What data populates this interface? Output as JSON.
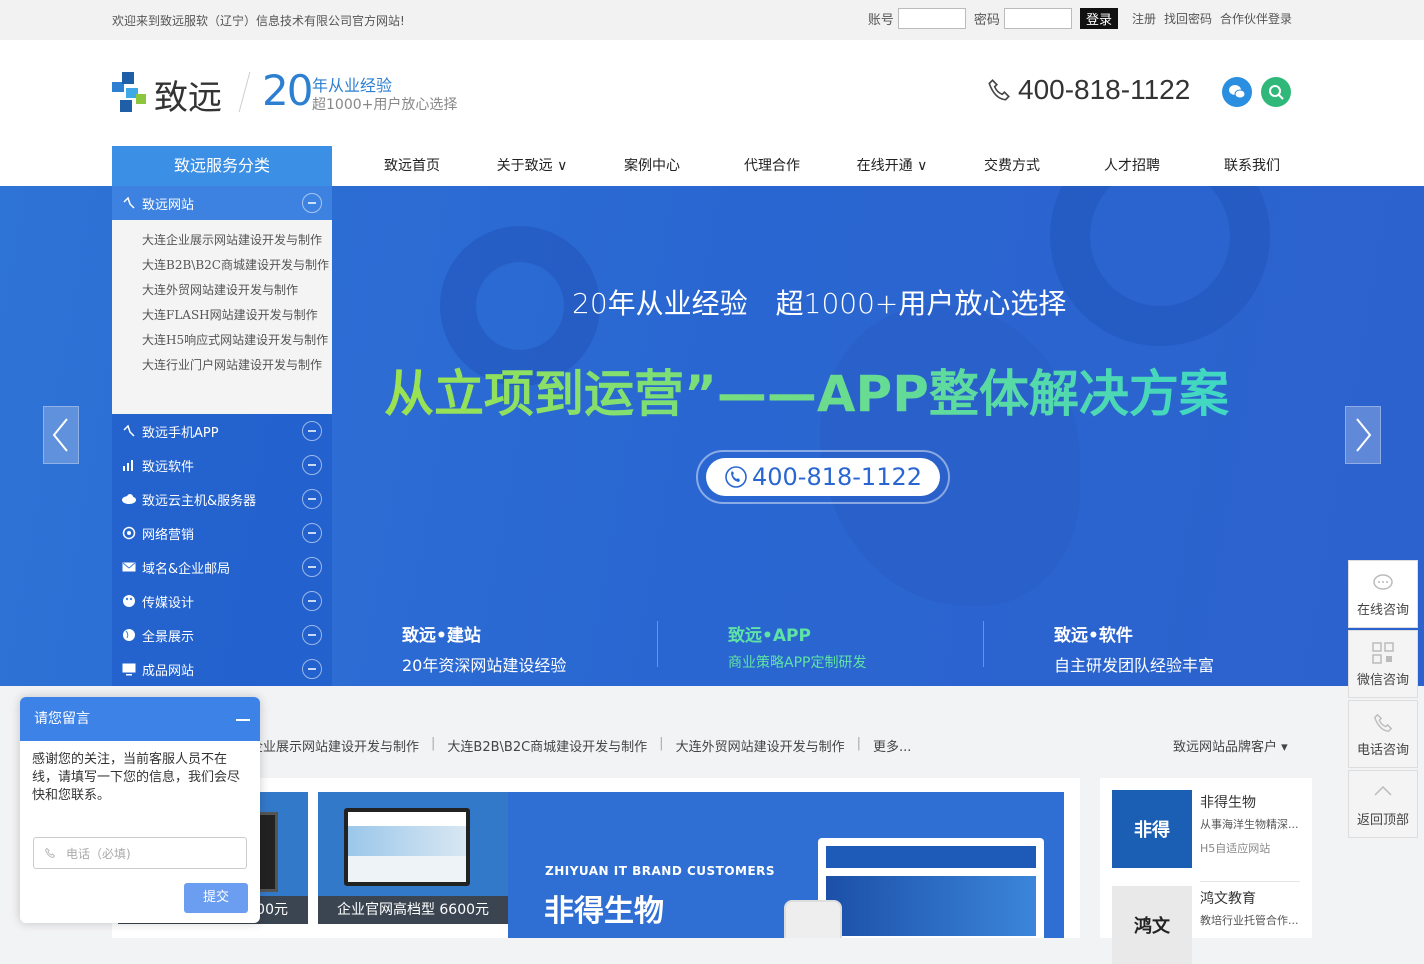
{
  "topbar": {
    "welcome": "欢迎来到致远服软（辽宁）信息技术有限公司官方网站!",
    "account_label": "账号",
    "password_label": "密码",
    "login_button": "登录",
    "register": "注册",
    "forgot": "找回密码",
    "partner_login": "合作伙伴登录"
  },
  "header": {
    "logo_text": "致远",
    "slogan_number": "20",
    "slogan_line1": "年从业经验",
    "slogan_line2": "超1000+用户放心选择",
    "phone": "400-818-1122"
  },
  "nav": {
    "service_head": "致远服务分类",
    "items": [
      "致远首页",
      "关于致远 ∨",
      "案例中心",
      "代理合作",
      "在线开通 ∨",
      "交费方式",
      "人才招聘",
      "联系我们"
    ]
  },
  "sidemenu": {
    "open_category": "致远网站",
    "sub_items": [
      "大连企业展示网站建设开发与制作",
      "大连B2B\\B2C商城建设开发与制作",
      "大连外贸网站建设开发与制作",
      "大连FLASH网站建设开发与制作",
      "大连H5响应式网站建设开发与制作",
      "大连行业门户网站建设开发与制作"
    ],
    "categories": [
      "致远手机APP",
      "致远软件",
      "致远云主机&服务器",
      "网络营销",
      "域名&企业邮局",
      "传媒设计",
      "全景展示",
      "成品网站"
    ]
  },
  "banner": {
    "subtitle": "20年从业经验　超1000+用户放心选择",
    "title": "从立项到运营”——APP整体解决方案",
    "phone": "400-818-1122",
    "features": [
      {
        "title": "致远•建站",
        "sub": "20年资深网站建设经验"
      },
      {
        "title": "致远•APP",
        "sub": "商业策略APP定制研发"
      },
      {
        "title": "致远•软件",
        "sub": "自主研发团队经验丰富"
      }
    ]
  },
  "cases": {
    "tabs": [
      "企业展示网站建设开发与制作",
      "大连B2B\\B2C商城建设开发与制作",
      "大连外贸网站建设开发与制作",
      "更多..."
    ],
    "brand_select": "致远网站品牌客户 ▾",
    "card1_caption": "00元",
    "card2_caption": "企业官网高档型 6600元",
    "big_en": "ZHIYUAN IT BRAND CUSTOMERS",
    "big_cn": "非得生物"
  },
  "clients": [
    {
      "name": "非得生物",
      "desc": "从事海洋生物精深...",
      "tag": "H5自适应网站"
    },
    {
      "name": "鸿文教育",
      "desc": "教培行业托管合作..."
    }
  ],
  "floatbar": [
    "在线咨询",
    "微信咨询",
    "电话咨询",
    "返回顶部"
  ],
  "message": {
    "title": "请您留言",
    "body": "感谢您的关注，当前客服人员不在线，请填写一下您的信息，我们会尽快和您联系。",
    "phone_placeholder": "电话（必填)",
    "submit": "提交"
  }
}
